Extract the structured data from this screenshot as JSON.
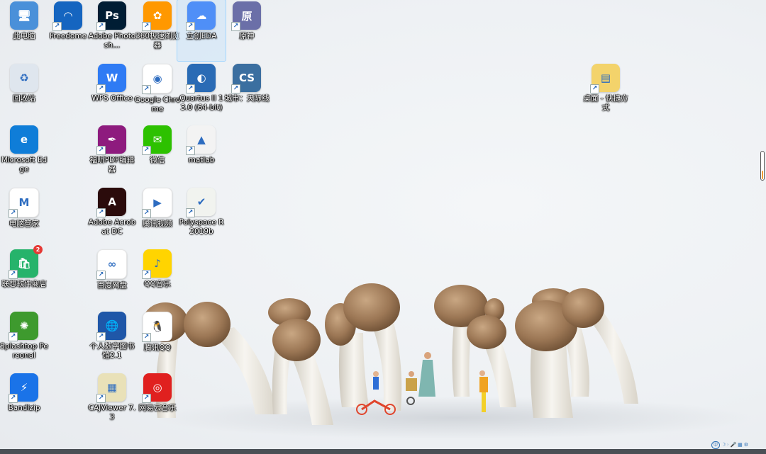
{
  "desktop": {
    "icons": [
      {
        "id": "this-pc",
        "label": "此电脑",
        "col": 0,
        "row": 0,
        "color": "#4a90d9",
        "glyph": "🖥",
        "shortcut": false
      },
      {
        "id": "freedome",
        "label": "Freedome",
        "col": 1,
        "row": 0,
        "color": "#1565c0",
        "glyph": "◠",
        "shortcut": true
      },
      {
        "id": "photoshop",
        "label": "Adobe Photosh...",
        "col": 2,
        "row": 0,
        "color": "#001d34",
        "glyph": "Ps",
        "shortcut": true
      },
      {
        "id": "360-browser",
        "label": "360极速浏览器",
        "col": 3,
        "row": 0,
        "color": "#ff9800",
        "glyph": "✿",
        "shortcut": true
      },
      {
        "id": "lceda",
        "label": "立创EDA",
        "col": 4,
        "row": 0,
        "color": "#4f8ff7",
        "glyph": "☁",
        "shortcut": true,
        "selected": true
      },
      {
        "id": "genshin",
        "label": "原神",
        "col": 5,
        "row": 0,
        "color": "#6b6fa8",
        "glyph": "原",
        "shortcut": true
      },
      {
        "id": "recycle-bin",
        "label": "回收站",
        "col": 0,
        "row": 1,
        "color": "#dfe6ee",
        "glyph": "♻",
        "shortcut": false
      },
      {
        "id": "wps",
        "label": "WPS Office",
        "col": 2,
        "row": 1,
        "color": "#2f7bf4",
        "glyph": "W",
        "shortcut": true
      },
      {
        "id": "chrome",
        "label": "Google Chrome",
        "col": 3,
        "row": 1,
        "color": "#ffffff",
        "glyph": "◉",
        "shortcut": true
      },
      {
        "id": "quartus",
        "label": "Quartus II 13.0 (64-bit)",
        "col": 4,
        "row": 1,
        "color": "#2a6bb5",
        "glyph": "◐",
        "shortcut": true
      },
      {
        "id": "cities",
        "label": "城市：天际线",
        "col": 5,
        "row": 1,
        "color": "#3b6fa0",
        "glyph": "CS",
        "shortcut": true
      },
      {
        "id": "desktop-shortcut",
        "label": "桌面 - 快捷方式",
        "col": 13,
        "row": 1,
        "color": "#f3d36b",
        "glyph": "▤",
        "shortcut": true
      },
      {
        "id": "edge",
        "label": "Microsoft Edge",
        "col": 0,
        "row": 2,
        "color": "#0f7dd8",
        "glyph": "e",
        "shortcut": false
      },
      {
        "id": "foxit",
        "label": "福昕PDF编辑器",
        "col": 2,
        "row": 2,
        "color": "#8e1b7e",
        "glyph": "✒",
        "shortcut": true
      },
      {
        "id": "wechat",
        "label": "微信",
        "col": 3,
        "row": 2,
        "color": "#2dc100",
        "glyph": "✉",
        "shortcut": true
      },
      {
        "id": "matlab",
        "label": "matlab",
        "col": 4,
        "row": 2,
        "color": "#f3f3f3",
        "glyph": "▲",
        "shortcut": true
      },
      {
        "id": "pc-manager",
        "label": "电脑管家",
        "col": 0,
        "row": 3,
        "color": "#ffffff",
        "glyph": "M",
        "shortcut": true
      },
      {
        "id": "acrobat",
        "label": "Adobe Acrobat DC",
        "col": 2,
        "row": 3,
        "color": "#2b0b0b",
        "glyph": "A",
        "shortcut": true
      },
      {
        "id": "tencent-video",
        "label": "腾讯视频",
        "col": 3,
        "row": 3,
        "color": "#ffffff",
        "glyph": "▶",
        "shortcut": true
      },
      {
        "id": "polyspace",
        "label": "Polyspace R2019b",
        "col": 4,
        "row": 3,
        "color": "#f1f3ef",
        "glyph": "✔",
        "shortcut": true
      },
      {
        "id": "lenovo-store",
        "label": "联想软件商店",
        "col": 0,
        "row": 4,
        "color": "#26b36b",
        "glyph": "🛍",
        "shortcut": true,
        "badge": "2"
      },
      {
        "id": "baidu-netdisk",
        "label": "百度网盘",
        "col": 2,
        "row": 4,
        "color": "#ffffff",
        "glyph": "∞",
        "shortcut": true
      },
      {
        "id": "qq-music",
        "label": "QQ音乐",
        "col": 3,
        "row": 4,
        "color": "#ffd400",
        "glyph": "♪",
        "shortcut": true
      },
      {
        "id": "splashtop",
        "label": "Splashtop Personal",
        "col": 0,
        "row": 5,
        "color": "#3e9a2e",
        "glyph": "✺",
        "shortcut": true
      },
      {
        "id": "digital-library",
        "label": "个人数字图书馆2.1",
        "col": 2,
        "row": 5,
        "color": "#1f57a8",
        "glyph": "🌐",
        "shortcut": true
      },
      {
        "id": "tencent-qq",
        "label": "腾讯QQ",
        "col": 3,
        "row": 5,
        "color": "#ffffff",
        "glyph": "🐧",
        "shortcut": true
      },
      {
        "id": "bandizip",
        "label": "Bandizip",
        "col": 0,
        "row": 6,
        "color": "#1a73e8",
        "glyph": "⚡",
        "shortcut": true
      },
      {
        "id": "cajviewer",
        "label": "CAJViewer 7.3",
        "col": 2,
        "row": 6,
        "color": "#e9e1b8",
        "glyph": "▦",
        "shortcut": true
      },
      {
        "id": "netease-music",
        "label": "网易云音乐",
        "col": 3,
        "row": 6,
        "color": "#e0201f",
        "glyph": "◎",
        "shortcut": true
      }
    ]
  },
  "taskbar": {
    "color": "#4a4f55"
  },
  "tray": {
    "ime_label": "中",
    "icons": [
      "ime-icon",
      "moon-icon",
      "comma-icon",
      "mic-icon",
      "grid-icon",
      "gear-icon"
    ],
    "glyphs": [
      "中",
      "☽",
      "˒",
      "🎤",
      "▦",
      "⚙"
    ]
  }
}
